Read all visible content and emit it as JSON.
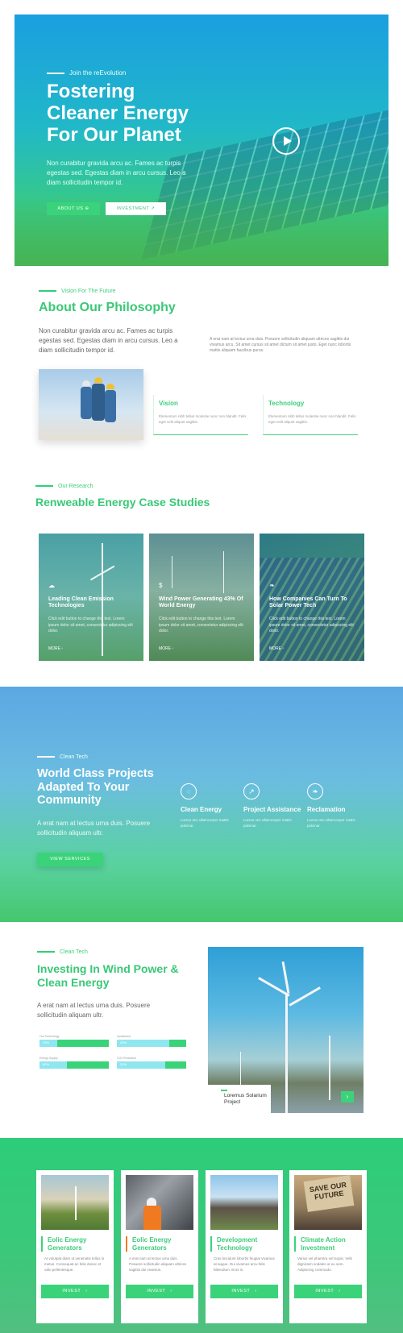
{
  "hero": {
    "eyebrow": "Join the reEvolution",
    "title": "Fostering Cleaner Energy For Our Planet",
    "description": "Non curabitur gravida arcu ac. Fames ac turpis egestas sed. Egestas diam in arcu cursus. Leo a diam sollicitudin tempor id.",
    "about_button": "ABOUT US",
    "invest_button": "INVESTMENT"
  },
  "philosophy": {
    "eyebrow": "Vision For The Future",
    "title": "About Our Philosophy",
    "description": "Non curabitur gravida arcu ac. Fames ac turpis egestas sed. Egestas diam in arcu cursus. Leo a diam sollicitudin tempor id.",
    "right_text": "A erat nam at lectus urna duis. Posuere sollicitudin aliquam ultrices sagittis dui vivamus arcu. Sit amet cursus sit amet dictum sit amet justo. Eget nunc lobortis mattis aliquam faucibus purus.",
    "features": [
      {
        "title": "Vision",
        "text": "Elementum nibh tellus molestie nunc non blandit. Felis eget velit aliquet sagittis."
      },
      {
        "title": "Technology",
        "text": "Elementum nibh tellus molestie nunc non blandit. Felis eget velit aliquet sagittis."
      }
    ]
  },
  "research": {
    "eyebrow": "Our Research",
    "title": "Renweable Energy Case Studies",
    "cards": [
      {
        "icon": "cloud-icon",
        "title": "Leading Clean Emission Technologies",
        "text": "Click edit button to change this text. Lorem ipsum dolor sit amet, consectetur adipiscing elit dolor.",
        "more": "MORE"
      },
      {
        "icon": "wind-dollar-icon",
        "title": "Wind Power Generating 43% Of World Energy",
        "text": "Click edit button to change this text. Lorem ipsum dolor sit amet, consectetur adipiscing elit dolor.",
        "more": "MORE"
      },
      {
        "icon": "leaf-icon",
        "title": "How Companies Can Turn To Solar Power Tech",
        "text": "Click edit button to change this text. Lorem ipsum dolor sit amet, consectetur adipiscing elit dolor.",
        "more": "MORE"
      }
    ]
  },
  "clean_tech": {
    "eyebrow": "Clean Tech",
    "title": "World Class Projects Adapted To Your Community",
    "description": "A erat nam at lectus urna duis. Posuere sollicitudin aliquam ultr.",
    "button": "VIEW SERVICES",
    "services": [
      {
        "icon": "lightbulb-icon",
        "title": "Clean Energy",
        "text": "Luctus nec ullamcorper mattis pulvinar."
      },
      {
        "icon": "chart-icon",
        "title": "Project Assistance",
        "text": "Luctus nec ullamcorper mattis pulvinar."
      },
      {
        "icon": "leaf-icon",
        "title": "Reclamation",
        "text": "Luctus nec ullamcorper mattis pulvinar."
      }
    ]
  },
  "wind": {
    "eyebrow": "Clean Tech",
    "title": "Investing In Wind Power & Clean Energy",
    "description": "A erat nam at lectus urna duis. Posuere sollicitudin aliquam ultr.",
    "bars": [
      {
        "label": "Our Technology",
        "value": "75%",
        "fill": 0.75
      },
      {
        "label": "Investment",
        "value": "25%",
        "fill": 0.25
      },
      {
        "label": "Energy Supply",
        "value": "60%",
        "fill": 0.6
      },
      {
        "label": "CO2 Reduction",
        "value": "30%",
        "fill": 0.3
      }
    ],
    "caption": "Loremus Solarium Project",
    "next_icon": "chevron-right-icon"
  },
  "invest_cards": [
    {
      "title": "Eolic Energy Generators",
      "text": "At volutpat diam ut venenatis tellus in metus. Consequat ac felis donec et odio pellentesque.",
      "button": "INVEST"
    },
    {
      "title": "Eolic Energy Generators",
      "text": "A erat nam at lectus urna duis. Posuere sollicitudin aliquam ultrices sagittis dui vivamus.",
      "button": "INVEST"
    },
    {
      "title": "Development Technology",
      "text": "Cras tincidunt lobortis feugiat vivamus at augue. Dui vivamus arcu felis bibendum. Eros in.",
      "button": "INVEST"
    },
    {
      "title": "Climate Action Investment",
      "text": "Varius vel pharetra vel turpis. Velit dignissim sodales ut eu sem. Adipiscing commodo.",
      "button": "INVEST"
    }
  ],
  "protest_sign_text": "SAVE OUR FUTURE"
}
